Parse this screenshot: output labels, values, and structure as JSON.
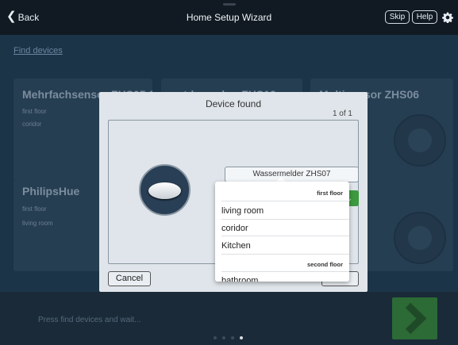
{
  "navbar": {
    "back_label": "Back",
    "title": "Home Setup Wizard",
    "skip_label": "Skip",
    "help_label": "Help"
  },
  "page": {
    "find_devices_link": "Find devices",
    "cards": [
      {
        "title": "Mehrfachsensor ZHS05 15",
        "floor": "first floor",
        "room": "coridor"
      },
      {
        "title": "outdoor plug ZHS12",
        "floor": "",
        "room": ""
      },
      {
        "title": "Multisensor ZHS06",
        "floor": "",
        "room": ""
      },
      {
        "title": "PhilipsHue",
        "floor": "first floor",
        "room": "living room"
      }
    ]
  },
  "bottom_bar": {
    "instruction": "Press find devices and wait...",
    "pages_total": 4,
    "page_active": 4
  },
  "modal": {
    "title": "Device found",
    "counter": "1 of 1",
    "device_name_value": "Wassermelder ZHS07",
    "room_selected": "bathroom",
    "cancel_label": "Cancel"
  },
  "dropdown": {
    "groups": [
      {
        "header": "first floor",
        "items": [
          "living room",
          "coridor",
          "Kitchen"
        ]
      },
      {
        "header": "second floor",
        "items": [
          "bathroom"
        ]
      }
    ]
  },
  "colors": {
    "accent_green": "#3c9a3f",
    "next_button": "#2c6a36",
    "background": "#1c3447",
    "overlay_modal": "#dfe5ea"
  },
  "icons": {
    "back": "chevron-left-icon",
    "settings": "gear-icon",
    "next": "chevron-right-icon",
    "dropdown": "chevron-down-icon"
  }
}
